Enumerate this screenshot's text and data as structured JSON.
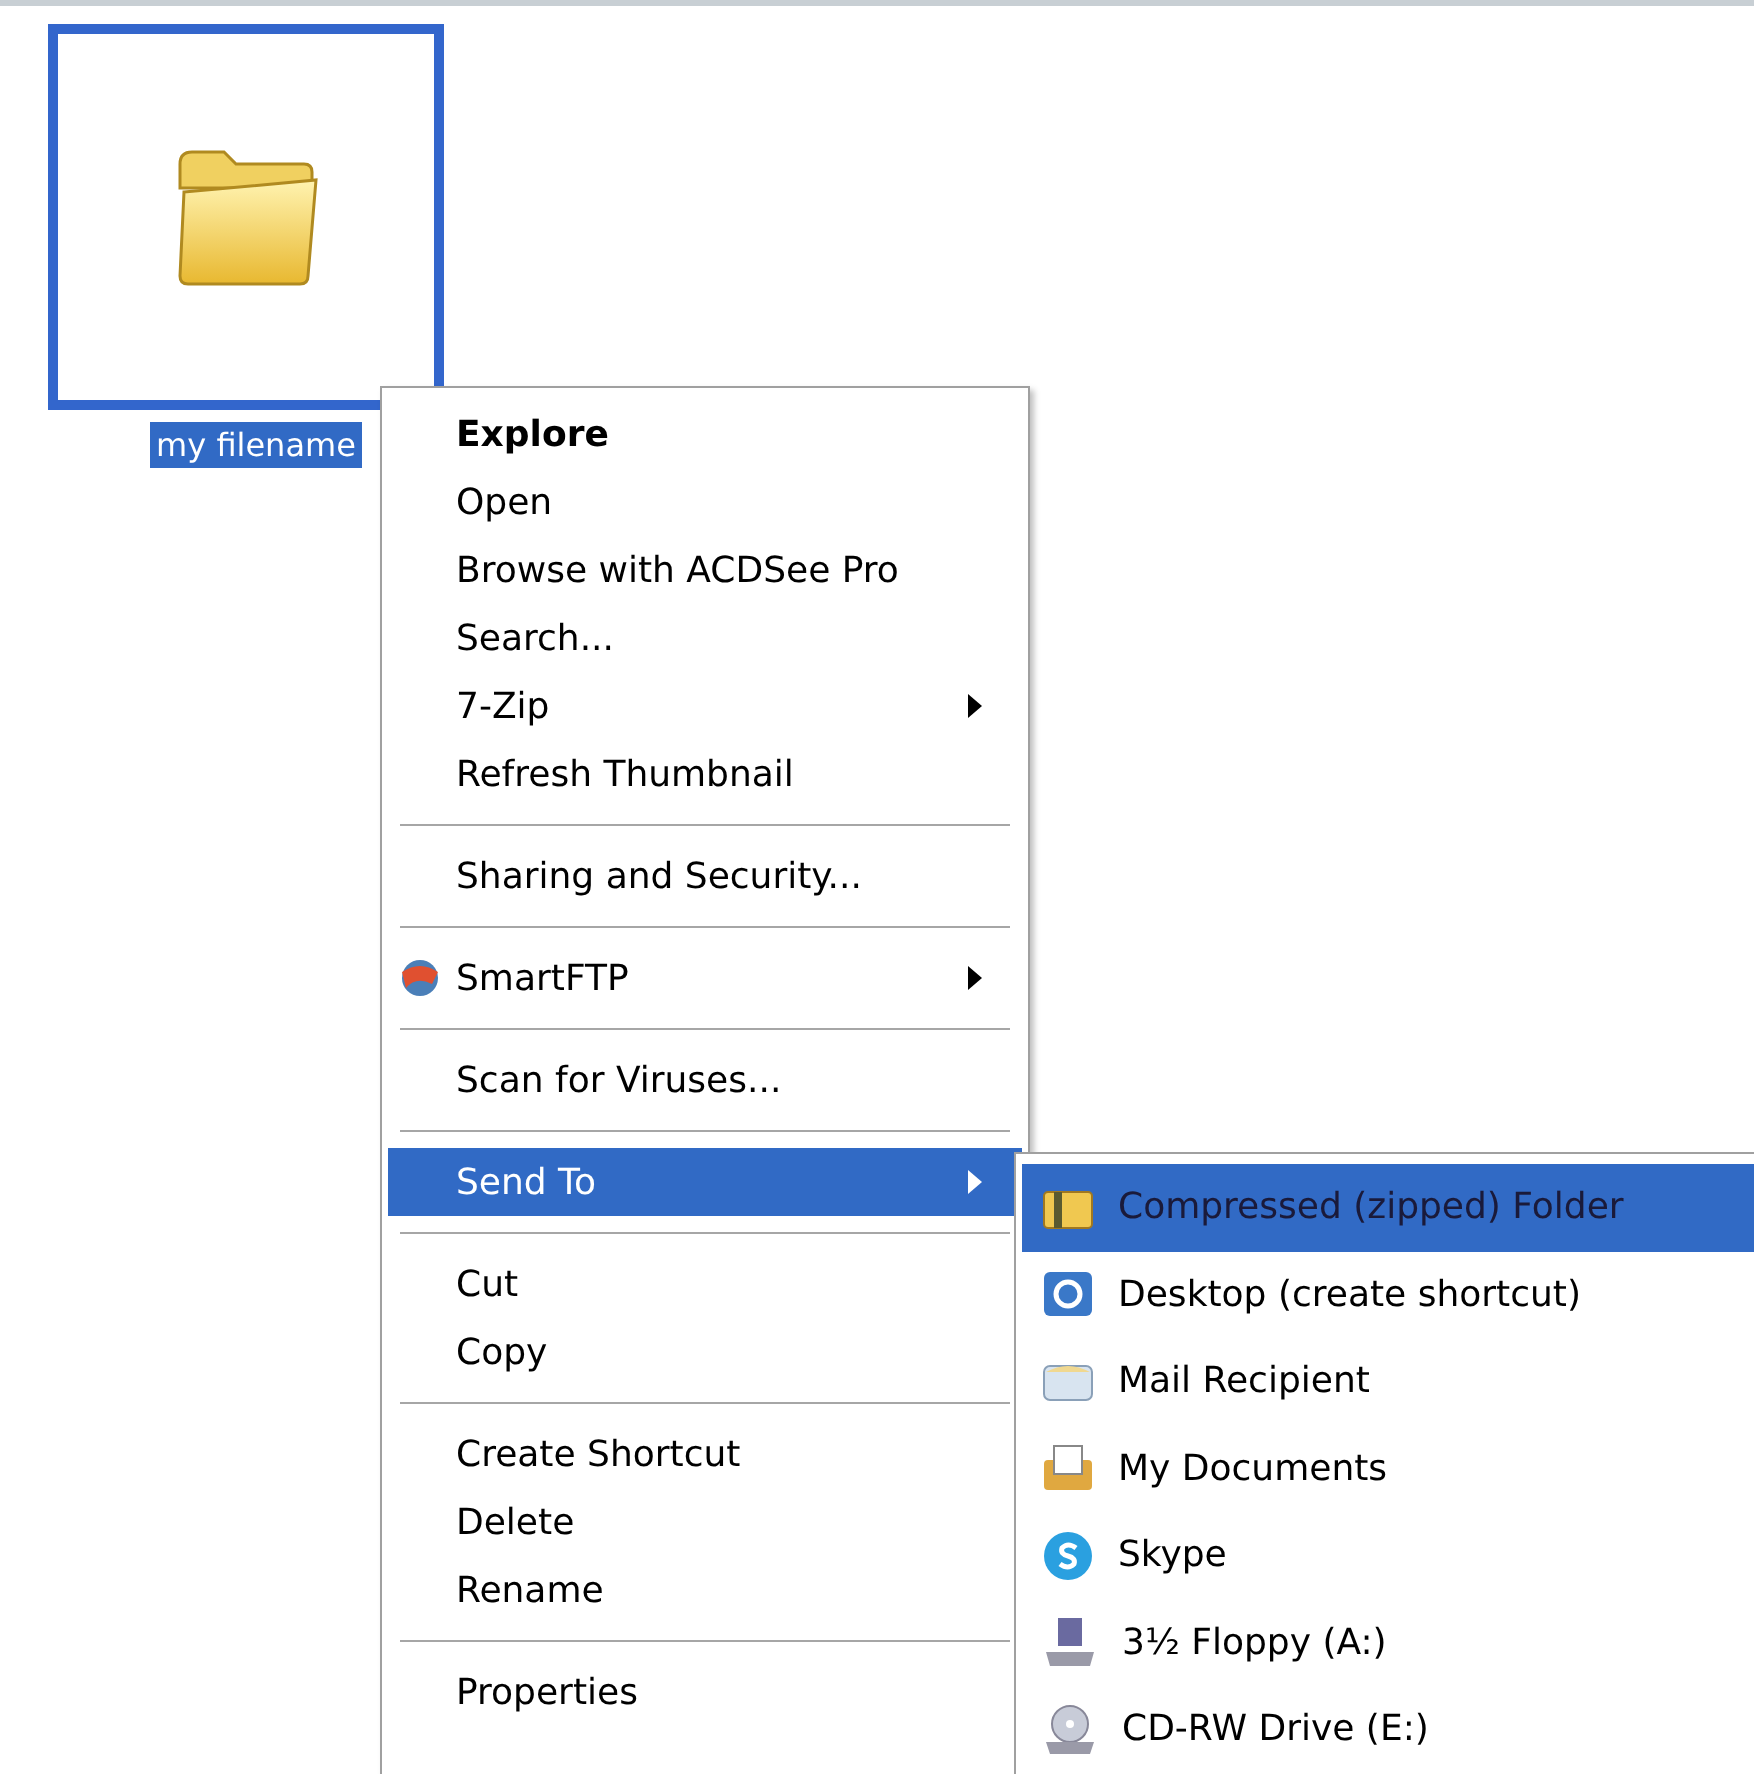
{
  "desktop_item": {
    "label": "my filename",
    "selected": true
  },
  "context_menu": {
    "items": [
      {
        "kind": "item",
        "label": "Explore",
        "default": true,
        "submenu": false,
        "selected": false,
        "icon": false
      },
      {
        "kind": "item",
        "label": "Open",
        "default": false,
        "submenu": false,
        "selected": false,
        "icon": false
      },
      {
        "kind": "item",
        "label": "Browse with ACDSee Pro",
        "default": false,
        "submenu": false,
        "selected": false,
        "icon": false
      },
      {
        "kind": "item",
        "label": "Search...",
        "default": false,
        "submenu": false,
        "selected": false,
        "icon": false
      },
      {
        "kind": "item",
        "label": "7-Zip",
        "default": false,
        "submenu": true,
        "selected": false,
        "icon": false
      },
      {
        "kind": "item",
        "label": "Refresh Thumbnail",
        "default": false,
        "submenu": false,
        "selected": false,
        "icon": false
      },
      {
        "kind": "separator"
      },
      {
        "kind": "item",
        "label": "Sharing and Security...",
        "default": false,
        "submenu": false,
        "selected": false,
        "icon": false
      },
      {
        "kind": "separator"
      },
      {
        "kind": "item",
        "label": "SmartFTP",
        "default": false,
        "submenu": true,
        "selected": false,
        "icon": true
      },
      {
        "kind": "separator"
      },
      {
        "kind": "item",
        "label": "Scan for Viruses...",
        "default": false,
        "submenu": false,
        "selected": false,
        "icon": false
      },
      {
        "kind": "separator"
      },
      {
        "kind": "item",
        "label": "Send To",
        "default": false,
        "submenu": true,
        "selected": true,
        "icon": false
      },
      {
        "kind": "separator"
      },
      {
        "kind": "item",
        "label": "Cut",
        "default": false,
        "submenu": false,
        "selected": false,
        "icon": false
      },
      {
        "kind": "item",
        "label": "Copy",
        "default": false,
        "submenu": false,
        "selected": false,
        "icon": false
      },
      {
        "kind": "separator"
      },
      {
        "kind": "item",
        "label": "Create Shortcut",
        "default": false,
        "submenu": false,
        "selected": false,
        "icon": false
      },
      {
        "kind": "item",
        "label": "Delete",
        "default": false,
        "submenu": false,
        "selected": false,
        "icon": false
      },
      {
        "kind": "item",
        "label": "Rename",
        "default": false,
        "submenu": false,
        "selected": false,
        "icon": false
      },
      {
        "kind": "separator"
      },
      {
        "kind": "item",
        "label": "Properties",
        "default": false,
        "submenu": false,
        "selected": false,
        "icon": false
      }
    ]
  },
  "send_to_menu": {
    "items": [
      {
        "label": "Compressed (zipped) Folder",
        "selected": true
      },
      {
        "label": "Desktop (create shortcut)",
        "selected": false
      },
      {
        "label": "Mail Recipient",
        "selected": false
      },
      {
        "label": "My Documents",
        "selected": false
      },
      {
        "label": "Skype",
        "selected": false
      },
      {
        "label": "3½ Floppy (A:)",
        "selected": false
      },
      {
        "label": "CD-RW Drive (E:)",
        "selected": false
      }
    ]
  }
}
